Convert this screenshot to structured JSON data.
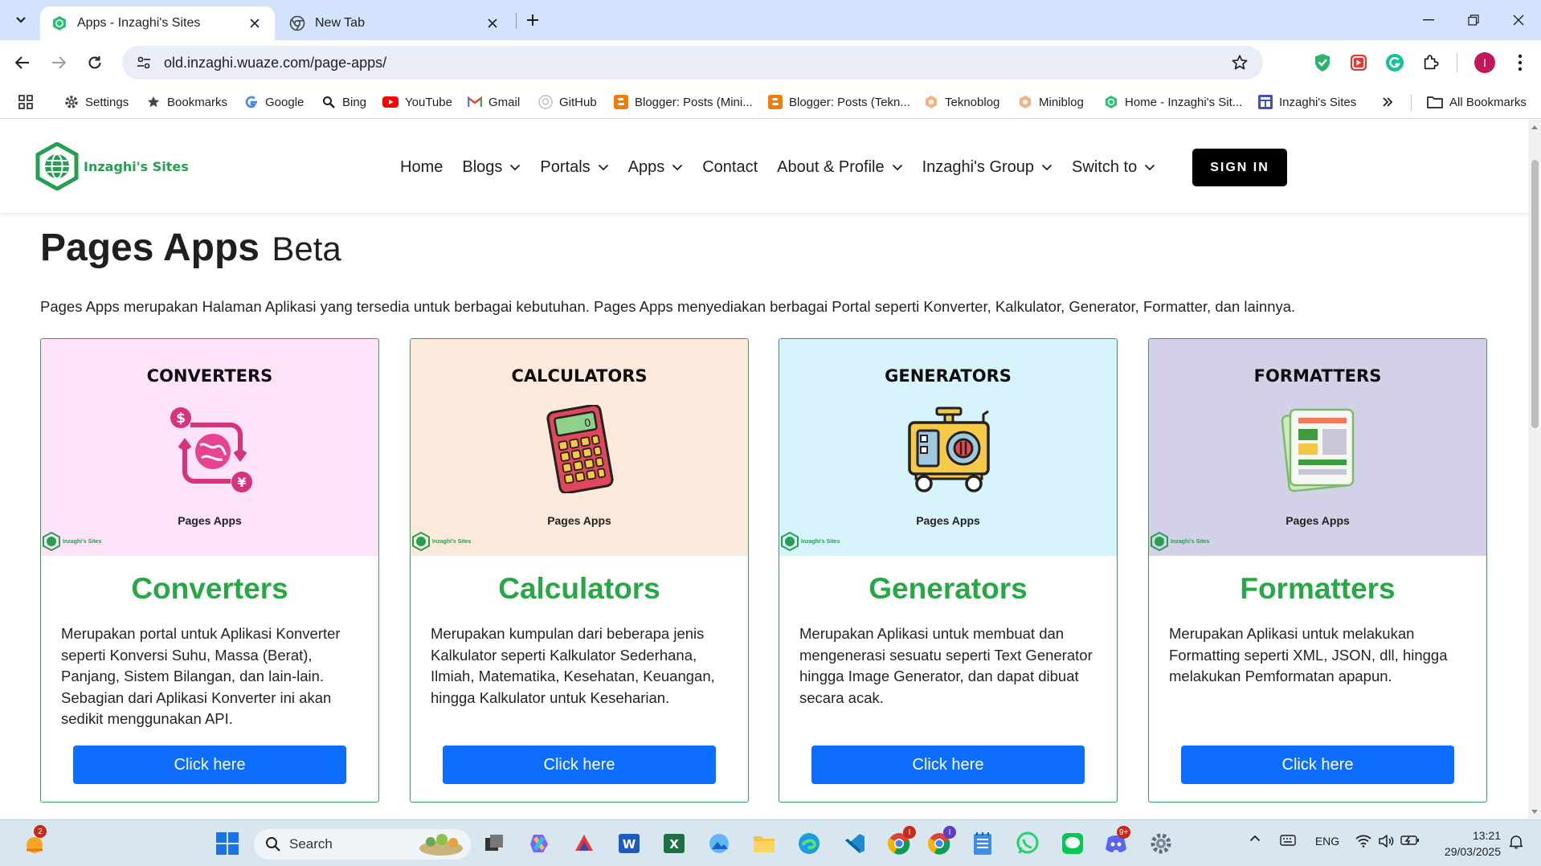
{
  "browser": {
    "tabs": [
      {
        "title": "Apps - Inzaghi's Sites",
        "active": true
      },
      {
        "title": "New Tab",
        "active": false
      }
    ],
    "url": "old.inzaghi.wuaze.com/page-apps/",
    "profile_initial": "I",
    "bookmarks": [
      {
        "label": "Settings",
        "icon": "gear-icon"
      },
      {
        "label": "Bookmarks",
        "icon": "star-icon"
      },
      {
        "label": "Google",
        "icon": "google-icon"
      },
      {
        "label": "Bing",
        "icon": "search-icon"
      },
      {
        "label": "YouTube",
        "icon": "youtube-icon"
      },
      {
        "label": "Gmail",
        "icon": "gmail-icon"
      },
      {
        "label": "GitHub",
        "icon": "github-icon"
      },
      {
        "label": "Blogger: Posts (Mini...",
        "icon": "blogger-icon"
      },
      {
        "label": "Blogger: Posts (Tekn...",
        "icon": "blogger-icon"
      },
      {
        "label": "Teknoblog",
        "icon": "hexagon-icon"
      },
      {
        "label": "Miniblog",
        "icon": "hexagon-icon"
      },
      {
        "label": "Home - Inzaghi's Sit...",
        "icon": "globe-icon"
      },
      {
        "label": "Inzaghi's Sites",
        "icon": "site-icon"
      }
    ],
    "all_bookmarks": "All Bookmarks"
  },
  "site": {
    "logo_text": "Inzaghi's Sites",
    "nav": [
      {
        "label": "Home",
        "dropdown": false
      },
      {
        "label": "Blogs",
        "dropdown": true
      },
      {
        "label": "Portals",
        "dropdown": true
      },
      {
        "label": "Apps",
        "dropdown": true
      },
      {
        "label": "Contact",
        "dropdown": false
      },
      {
        "label": "About & Profile",
        "dropdown": true
      },
      {
        "label": "Inzaghi's Group",
        "dropdown": true
      },
      {
        "label": "Switch to",
        "dropdown": true
      }
    ],
    "sign_in": "SIGN IN"
  },
  "content": {
    "title": "Pages Apps",
    "title_badge": "Beta",
    "intro": "Pages Apps merupakan Halaman Aplikasi yang tersedia untuk berbagai kebutuhan. Pages Apps menyediakan berbagai Portal seperti Konverter, Kalkulator, Generator, Formatter, dan lainnya.",
    "cards": [
      {
        "image_title": "CONVERTERS",
        "image_caption": "Pages Apps",
        "image_brand": "Inzaghi's Sites",
        "heading": "Converters",
        "text": "Merupakan portal untuk Aplikasi Konverter seperti Konversi Suhu, Massa (Berat), Panjang, Sistem Bilangan, dan lain-lain. Sebagian dari Aplikasi Konverter ini akan sedikit menggunakan API.",
        "button": "Click here",
        "bg": "#fde3f8",
        "icon": "currency-exchange-icon"
      },
      {
        "image_title": "CALCULATORS",
        "image_caption": "Pages Apps",
        "image_brand": "Inzaghi's Sites",
        "heading": "Calculators",
        "text": "Merupakan kumpulan dari beberapa jenis Kalkulator seperti Kalkulator Sederhana, Ilmiah, Matematika, Kesehatan, Keuangan, hingga Kalkulator untuk Keseharian.",
        "button": "Click here",
        "bg": "#fbeadb",
        "icon": "calculator-icon"
      },
      {
        "image_title": "GENERATORS",
        "image_caption": "Pages Apps",
        "image_brand": "Inzaghi's Sites",
        "heading": "Generators",
        "text": "Merupakan Aplikasi untuk membuat dan mengenerasi sesuatu seperti Text Generator hingga Image Generator, dan dapat dibuat secara acak.",
        "button": "Click here",
        "bg": "#d7f3fc",
        "icon": "generator-icon"
      },
      {
        "image_title": "FORMATTERS",
        "image_caption": "Pages Apps",
        "image_brand": "Inzaghi's Sites",
        "heading": "Formatters",
        "text": "Merupakan Aplikasi untuk melakukan Formatting seperti XML, JSON, dll, hingga melakukan Pemformatan apapun.",
        "button": "Click here",
        "bg": "#d2d1e8",
        "icon": "document-layout-icon"
      }
    ]
  },
  "taskbar": {
    "search_placeholder": "Search",
    "language": "ENG",
    "time": "13:21",
    "date": "29/03/2025",
    "widget_badge": "2",
    "chrome_badge": "I",
    "chrome2_badge": "I",
    "discord_badge": "9+"
  },
  "colors": {
    "brand_green": "#23a050",
    "heading_green": "#28a745",
    "button_blue": "#0d6efd",
    "tabbar": "#d3e3fd"
  }
}
